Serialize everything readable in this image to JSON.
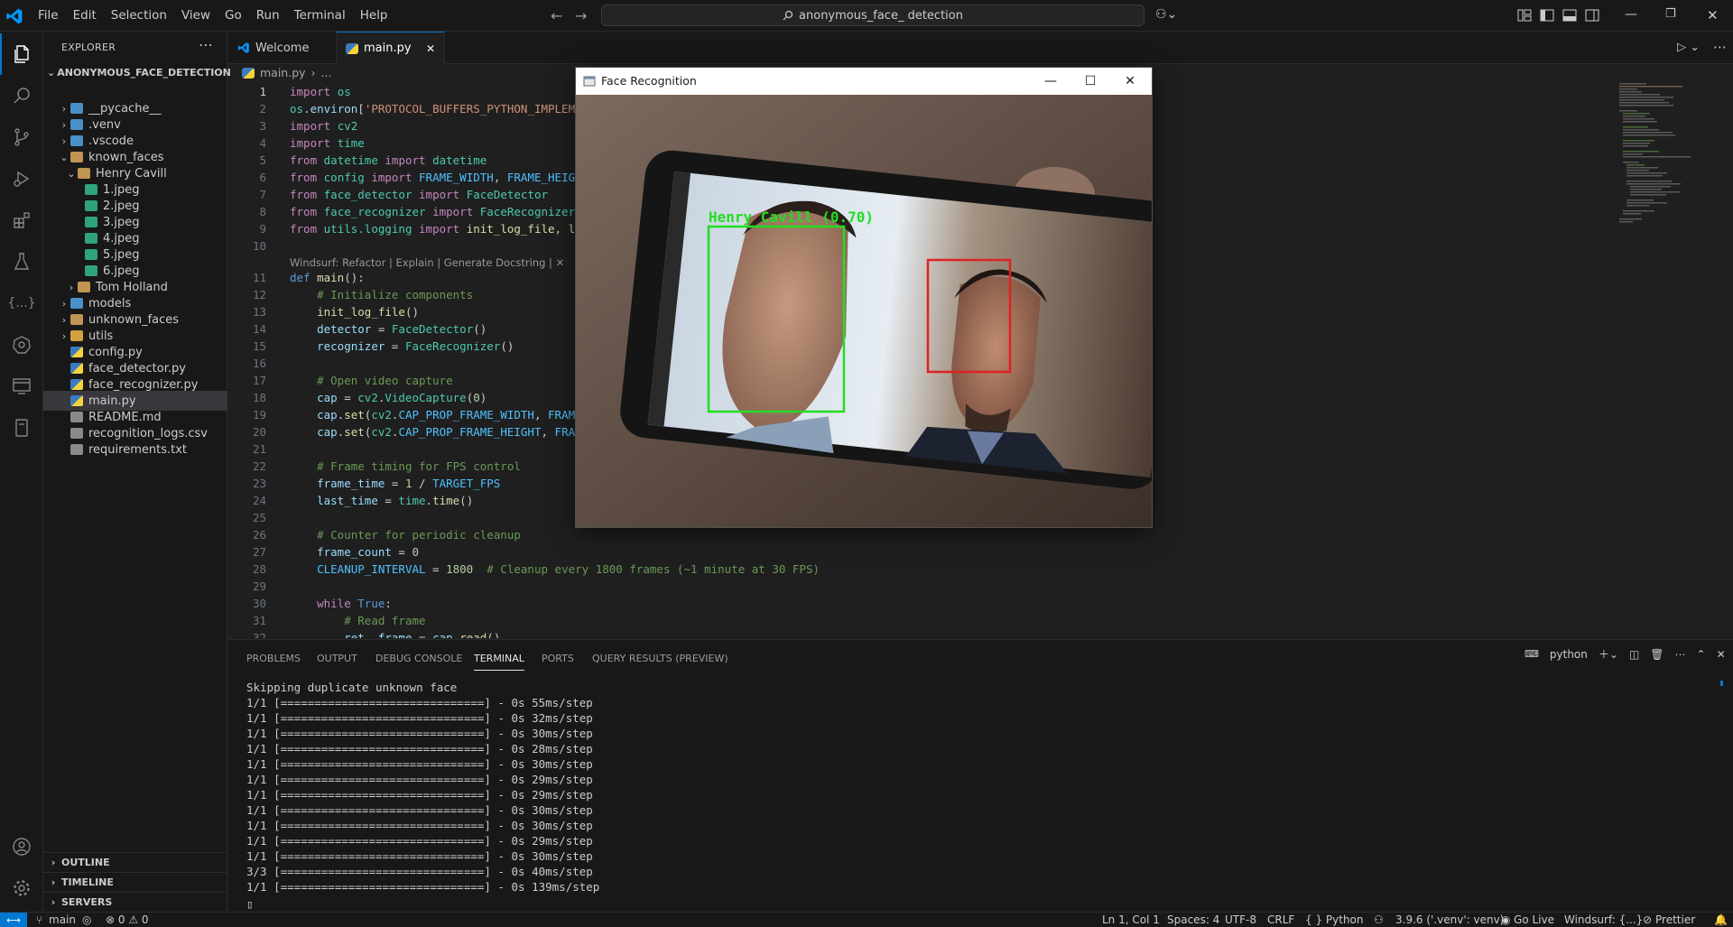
{
  "menubar": {
    "items": [
      "File",
      "Edit",
      "Selection",
      "View",
      "Go",
      "Run",
      "Terminal",
      "Help"
    ]
  },
  "command_center": {
    "text": "anonymous_face_ detection"
  },
  "sidebar": {
    "title": "EXPLORER",
    "project": "ANONYMOUS_FACE_DETECTION",
    "tree": [
      {
        "label": "__pycache__",
        "chev": "›"
      },
      {
        "label": ".venv",
        "chev": "›"
      },
      {
        "label": ".vscode",
        "chev": "›"
      },
      {
        "label": "known_faces",
        "chev": "⌄"
      },
      {
        "label": "Henry Cavill",
        "chev": "⌄"
      },
      {
        "label": "1.jpeg",
        "chev": ""
      },
      {
        "label": "2.jpeg",
        "chev": ""
      },
      {
        "label": "3.jpeg",
        "chev": ""
      },
      {
        "label": "4.jpeg",
        "chev": ""
      },
      {
        "label": "5.jpeg",
        "chev": ""
      },
      {
        "label": "6.jpeg",
        "chev": ""
      },
      {
        "label": "Tom Holland",
        "chev": "›"
      },
      {
        "label": "models",
        "chev": "›"
      },
      {
        "label": "unknown_faces",
        "chev": "›"
      },
      {
        "label": "utils",
        "chev": "›"
      },
      {
        "label": "config.py",
        "chev": ""
      },
      {
        "label": "face_detector.py",
        "chev": ""
      },
      {
        "label": "face_recognizer.py",
        "chev": ""
      },
      {
        "label": "main.py",
        "chev": ""
      },
      {
        "label": "README.md",
        "chev": ""
      },
      {
        "label": "recognition_logs.csv",
        "chev": ""
      },
      {
        "label": "requirements.txt",
        "chev": ""
      }
    ],
    "sections": [
      "OUTLINE",
      "TIMELINE",
      "SERVERS"
    ]
  },
  "tabs": [
    {
      "label": "Welcome"
    },
    {
      "label": "main.py"
    }
  ],
  "breadcrumb": {
    "file": "main.py",
    "rest": "..."
  },
  "editor": {
    "codelens": "Windsurf: Refactor | Explain | Generate Docstring | ✕",
    "line_numbers": [
      "1",
      "2",
      "3",
      "4",
      "5",
      "6",
      "7",
      "8",
      "9",
      "10",
      "11",
      "12",
      "13",
      "14",
      "15",
      "16",
      "17",
      "18",
      "19",
      "20",
      "21",
      "22",
      "23",
      "24",
      "25",
      "26",
      "27",
      "28",
      "29",
      "30",
      "31",
      "32"
    ]
  },
  "panel": {
    "tabs": [
      "PROBLEMS",
      "OUTPUT",
      "DEBUG CONSOLE",
      "TERMINAL",
      "PORTS",
      "QUERY RESULTS (PREVIEW)"
    ],
    "terminal_label": "python",
    "lines": [
      "Skipping duplicate unknown face",
      "1/1 [==============================] - 0s 55ms/step",
      "1/1 [==============================] - 0s 32ms/step",
      "1/1 [==============================] - 0s 30ms/step",
      "1/1 [==============================] - 0s 28ms/step",
      "1/1 [==============================] - 0s 30ms/step",
      "1/1 [==============================] - 0s 29ms/step",
      "1/1 [==============================] - 0s 29ms/step",
      "1/1 [==============================] - 0s 30ms/step",
      "1/1 [==============================] - 0s 30ms/step",
      "1/1 [==============================] - 0s 29ms/step",
      "1/1 [==============================] - 0s 30ms/step",
      "3/3 [==============================] - 0s 40ms/step",
      "1/1 [==============================] - 0s 139ms/step"
    ]
  },
  "statusbar": {
    "branch": "main",
    "problems": "⊗ 0 ⚠ 0",
    "position": "Ln 1, Col 1",
    "spaces": "Spaces: 4",
    "encoding": "UTF-8",
    "eol": "CRLF",
    "language": "{ } Python",
    "interpreter": "3.9.6 ('.venv': venv)",
    "golive": "Go Live",
    "windsurf": "Windsurf: {...}",
    "prettier": "Prettier"
  },
  "face_window": {
    "title": "Face Recognition",
    "detection_label": "Henry Cavill (0.70)",
    "known_color": "#22dd22",
    "unknown_color": "#dd2222"
  },
  "colors": {
    "accent": "#0078d4"
  }
}
